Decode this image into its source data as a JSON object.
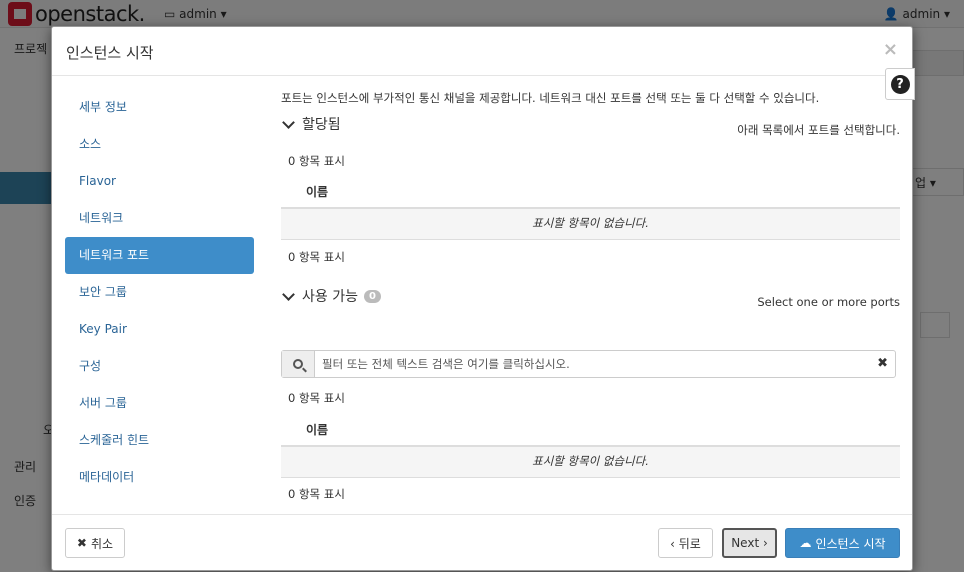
{
  "app": {
    "brand": "openstack.",
    "project_menu": "admin",
    "user_menu": "admin"
  },
  "background": {
    "sidebar_items": [
      "프로젝ト",
      "관리",
      "인증"
    ],
    "fragments": [
      "업",
      "오"
    ]
  },
  "modal": {
    "title": "인스턴스 시작",
    "close": "×",
    "help": "?",
    "steps": [
      {
        "label": "세부 정보",
        "active": false
      },
      {
        "label": "소스",
        "active": false
      },
      {
        "label": "Flavor",
        "active": false
      },
      {
        "label": "네트워크",
        "active": false
      },
      {
        "label": "네트워크 포트",
        "active": true
      },
      {
        "label": "보안 그룹",
        "active": false
      },
      {
        "label": "Key Pair",
        "active": false
      },
      {
        "label": "구성",
        "active": false
      },
      {
        "label": "서버 그룹",
        "active": false
      },
      {
        "label": "스케줄러 힌트",
        "active": false
      },
      {
        "label": "메타데이터",
        "active": false
      }
    ],
    "intro": "포트는 인스턴스에 부가적인 통신 채널을 제공합니다. 네트워크 대신 포트를 선택 또는 둘 다 선택할 수 있습니다.",
    "allocated": {
      "title": "할당됨",
      "hint": "아래 목록에서 포트를 선택합니다.",
      "count_top": "0 항목 표시",
      "column": "이름",
      "empty": "표시할 항목이 없습니다.",
      "count_bottom": "0 항목 표시"
    },
    "available": {
      "title": "사용 가능",
      "badge": "0",
      "hint": "Select one or more ports",
      "search_placeholder": "필터 또는 전체 텍스트 검색은 여기를 클릭하십시오.",
      "count_top": "0 항목 표시",
      "column": "이름",
      "empty": "표시할 항목이 없습니다.",
      "count_bottom": "0 항목 표시"
    },
    "footer": {
      "cancel": "취소",
      "back": "‹ 뒤로",
      "next": "Next ›",
      "launch": "인스턴스 시작"
    }
  }
}
